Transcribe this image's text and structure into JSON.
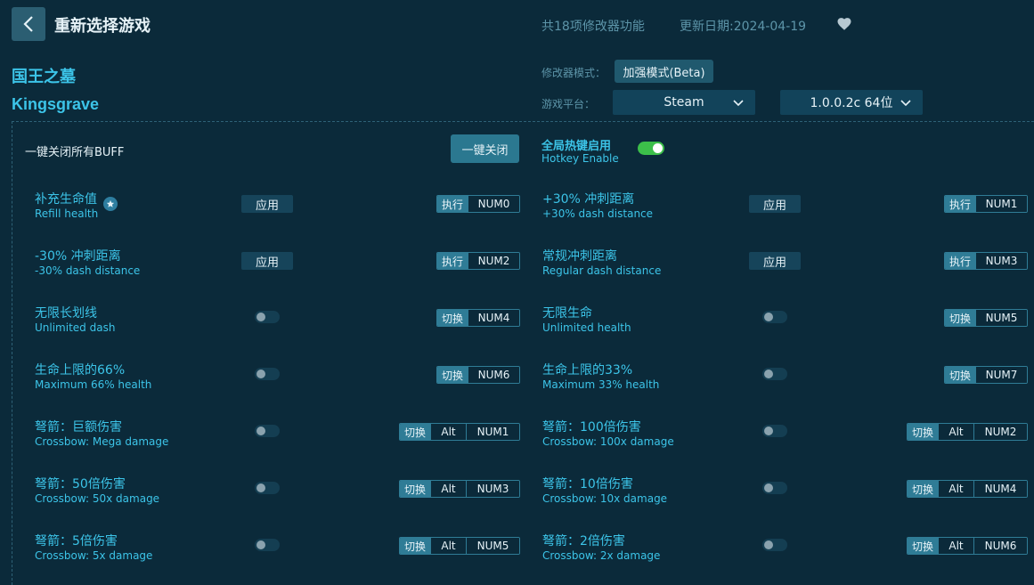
{
  "header": {
    "title": "重新选择游戏",
    "feature_count": "共18项修改器功能",
    "update_date": "更新日期:2024-04-19"
  },
  "game": {
    "name_cn": "国王之墓",
    "name_en": "Kingsgrave"
  },
  "settings": {
    "mode_label": "修改器模式：",
    "mode_value": "加强模式(Beta)",
    "platform_label": "游戏平台：",
    "platform_value": "Steam",
    "version_value": "1.0.0.2c 64位"
  },
  "controls": {
    "buff_label": "一键关闭所有BUFF",
    "close_all_button": "一键关闭",
    "hotkey_cn": "全局热键启用",
    "hotkey_en": "Hotkey Enable",
    "hotkey_enabled": true
  },
  "options": [
    {
      "cn": "补充生命值",
      "en": "Refill health",
      "type": "apply",
      "apply_label": "应用",
      "action": "执行",
      "keys": [
        "NUM0"
      ],
      "starred": true
    },
    {
      "cn": "+30% 冲刺距离",
      "en": "+30% dash distance",
      "type": "apply",
      "apply_label": "应用",
      "action": "执行",
      "keys": [
        "NUM1"
      ]
    },
    {
      "cn": "-30% 冲刺距离",
      "en": "-30% dash distance",
      "type": "apply",
      "apply_label": "应用",
      "action": "执行",
      "keys": [
        "NUM2"
      ]
    },
    {
      "cn": "常规冲刺距离",
      "en": "Regular dash distance",
      "type": "apply",
      "apply_label": "应用",
      "action": "执行",
      "keys": [
        "NUM3"
      ]
    },
    {
      "cn": "无限长划线",
      "en": "Unlimited dash",
      "type": "toggle",
      "on": false,
      "action": "切换",
      "keys": [
        "NUM4"
      ]
    },
    {
      "cn": "无限生命",
      "en": "Unlimited health",
      "type": "toggle",
      "on": false,
      "action": "切换",
      "keys": [
        "NUM5"
      ]
    },
    {
      "cn": "生命上限的66%",
      "en": "Maximum 66% health",
      "type": "toggle",
      "on": false,
      "action": "切换",
      "keys": [
        "NUM6"
      ]
    },
    {
      "cn": "生命上限的33%",
      "en": "Maximum 33% health",
      "type": "toggle",
      "on": false,
      "action": "切换",
      "keys": [
        "NUM7"
      ]
    },
    {
      "cn": "弩箭：巨额伤害",
      "en": "Crossbow: Mega damage",
      "type": "toggle",
      "on": false,
      "action": "切换",
      "keys": [
        "Alt",
        "NUM1"
      ]
    },
    {
      "cn": "弩箭：100倍伤害",
      "en": "Crossbow: 100x damage",
      "type": "toggle",
      "on": false,
      "action": "切换",
      "keys": [
        "Alt",
        "NUM2"
      ]
    },
    {
      "cn": "弩箭：50倍伤害",
      "en": "Crossbow: 50x damage",
      "type": "toggle",
      "on": false,
      "action": "切换",
      "keys": [
        "Alt",
        "NUM3"
      ]
    },
    {
      "cn": "弩箭：10倍伤害",
      "en": "Crossbow: 10x damage",
      "type": "toggle",
      "on": false,
      "action": "切换",
      "keys": [
        "Alt",
        "NUM4"
      ]
    },
    {
      "cn": "弩箭：5倍伤害",
      "en": "Crossbow: 5x damage",
      "type": "toggle",
      "on": false,
      "action": "切换",
      "keys": [
        "Alt",
        "NUM5"
      ]
    },
    {
      "cn": "弩箭：2倍伤害",
      "en": "Crossbow: 2x damage",
      "type": "toggle",
      "on": false,
      "action": "切换",
      "keys": [
        "Alt",
        "NUM6"
      ]
    }
  ]
}
